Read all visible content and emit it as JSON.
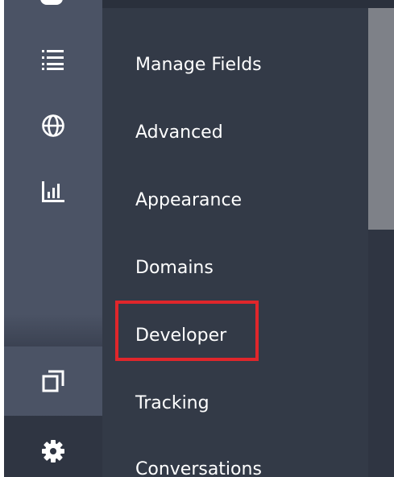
{
  "sidebar": {
    "icons": [
      {
        "name": "list-icon"
      },
      {
        "name": "globe-icon"
      },
      {
        "name": "bar-chart-icon"
      },
      {
        "name": "copy-window-icon"
      },
      {
        "name": "gear-icon"
      }
    ]
  },
  "menu": {
    "items": [
      {
        "label": "Manage Fields"
      },
      {
        "label": "Advanced"
      },
      {
        "label": "Appearance"
      },
      {
        "label": "Domains"
      },
      {
        "label": "Developer"
      },
      {
        "label": "Tracking"
      },
      {
        "label": "Conversations"
      }
    ],
    "highlighted_index": 4
  },
  "colors": {
    "rail": "#4b5365",
    "menu_background": "#333a47",
    "text": "#ffffff",
    "highlight": "#e0262b",
    "scrollbar_thumb": "#7e8188"
  }
}
